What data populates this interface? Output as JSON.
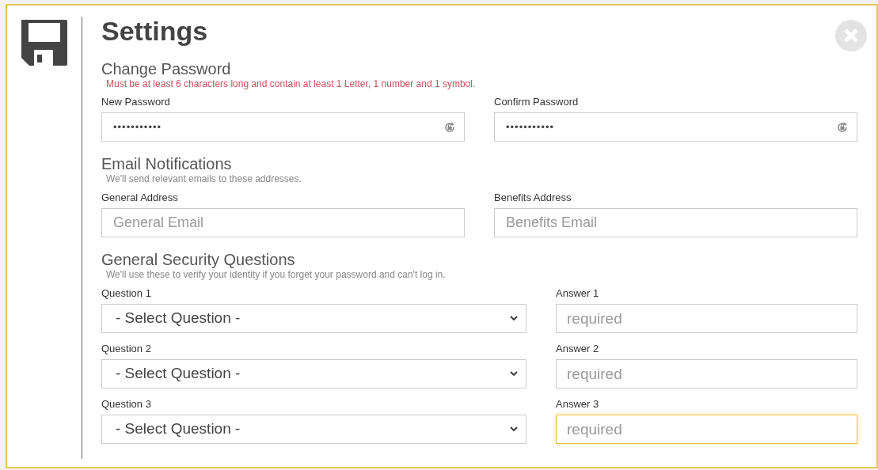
{
  "title": "Settings",
  "sections": [
    {
      "kind": "password",
      "heading": "Change Password",
      "note": "Must be at least 6 characters long and contain at least 1 Letter, 1 number and 1 symbol.",
      "warning": true,
      "fields": [
        {
          "label": "New Password",
          "value": "•••••••••••"
        },
        {
          "label": "Confirm Password",
          "value": "•••••••••••"
        }
      ]
    },
    {
      "kind": "email",
      "heading": "Email Notifications",
      "note": "We'll send relevant emails to these addresses.",
      "warning": false,
      "fields": [
        {
          "label": "General Address",
          "placeholder": "General Email"
        },
        {
          "label": "Benefits Address",
          "placeholder": "Benefits Email"
        }
      ]
    },
    {
      "kind": "questions",
      "heading": "General Security Questions",
      "note": "We'll use these to verify your identity if you forget your password and can't log in.",
      "warning": false,
      "rows": [
        {
          "question_label": "Question 1",
          "question": "- Select Question -",
          "answer_label": "Answer 1",
          "placeholder": "required",
          "focused": false
        },
        {
          "question_label": "Question 2",
          "question": "- Select Question -",
          "answer_label": "Answer 2",
          "placeholder": "required",
          "focused": false
        },
        {
          "question_label": "Question 3",
          "question": "- Select Question -",
          "answer_label": "Answer 3",
          "placeholder": "required",
          "focused": true
        }
      ]
    }
  ]
}
